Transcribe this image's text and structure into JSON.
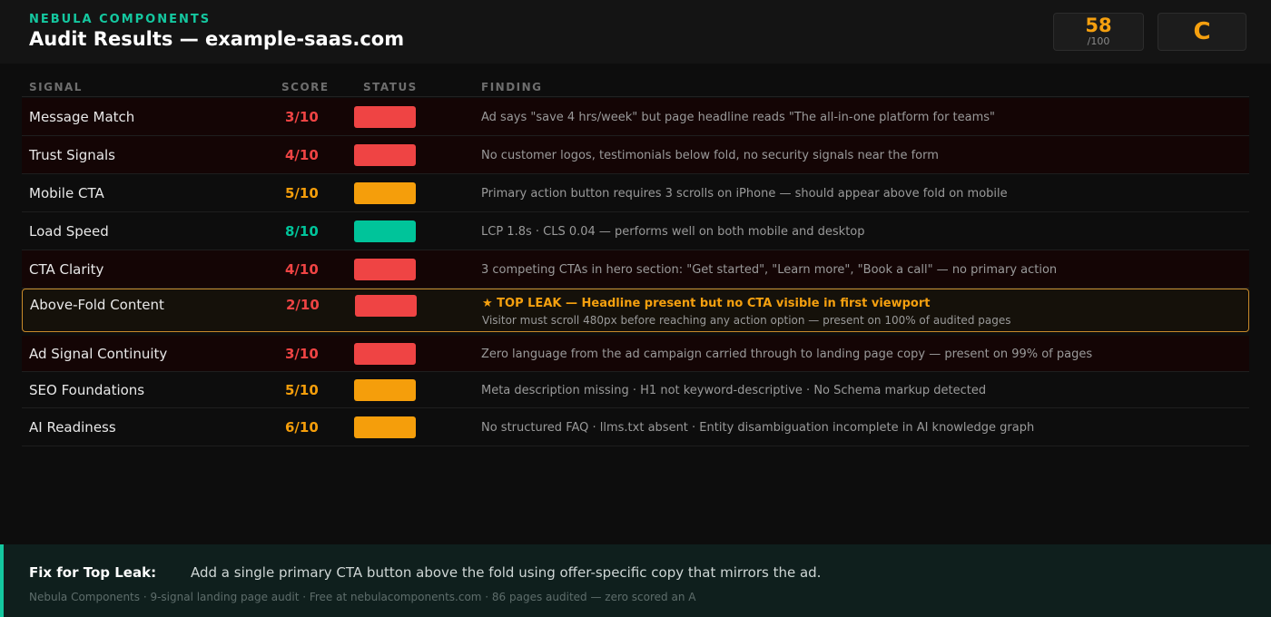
{
  "header": {
    "brand": "NEBULA COMPONENTS",
    "title": "Audit Results — example-saas.com",
    "score": "58",
    "score_max": "/100",
    "grade": "C"
  },
  "columns": {
    "signal": "SIGNAL",
    "score": "SCORE",
    "status": "STATUS",
    "finding": "FINDING"
  },
  "colors": {
    "red": "#ef4444",
    "orange": "#f59e0b",
    "green": "#00c49a",
    "top_border": "#c98a2a"
  },
  "rows": [
    {
      "signal": "Message Match",
      "score": "3/10",
      "status": "red",
      "finding": "Ad says \"save 4 hrs/week\" but page headline reads \"The all-in-one platform for teams\""
    },
    {
      "signal": "Trust Signals",
      "score": "4/10",
      "status": "red",
      "finding": "No customer logos, testimonials below fold, no security signals near the form"
    },
    {
      "signal": "Mobile CTA",
      "score": "5/10",
      "status": "orange",
      "finding": "Primary action button requires 3 scrolls on iPhone — should appear above fold on mobile"
    },
    {
      "signal": "Load Speed",
      "score": "8/10",
      "status": "green",
      "finding": "LCP 1.8s · CLS 0.04 — performs well on both mobile and desktop"
    },
    {
      "signal": "CTA Clarity",
      "score": "4/10",
      "status": "red",
      "finding": "3 competing CTAs in hero section: \"Get started\", \"Learn more\", \"Book a call\" — no primary action"
    },
    {
      "signal": "Above-Fold Content",
      "score": "2/10",
      "status": "red",
      "top_leak": true,
      "finding": "★ TOP LEAK — Headline present but no CTA visible in first viewport",
      "finding_detail": "Visitor must scroll 480px before reaching any action option — present on 100% of audited pages"
    },
    {
      "signal": "Ad Signal Continuity",
      "score": "3/10",
      "status": "red",
      "finding": "Zero language from the ad campaign carried through to landing page copy — present on 99% of pages"
    },
    {
      "signal": "SEO Foundations",
      "score": "5/10",
      "status": "orange",
      "finding": "Meta description missing · H1 not keyword-descriptive · No Schema markup detected"
    },
    {
      "signal": "AI Readiness",
      "score": "6/10",
      "status": "orange",
      "finding": "No structured FAQ · llms.txt absent · Entity disambiguation incomplete in AI knowledge graph"
    }
  ],
  "footer": {
    "fix_label": "Fix for Top Leak:",
    "fix_text": "Add a single primary CTA button above the fold using offer-specific copy that mirrors the ad.",
    "credit": "Nebula Components · 9-signal landing page audit · Free at nebulacomponents.com · 86 pages audited — zero scored an A"
  }
}
